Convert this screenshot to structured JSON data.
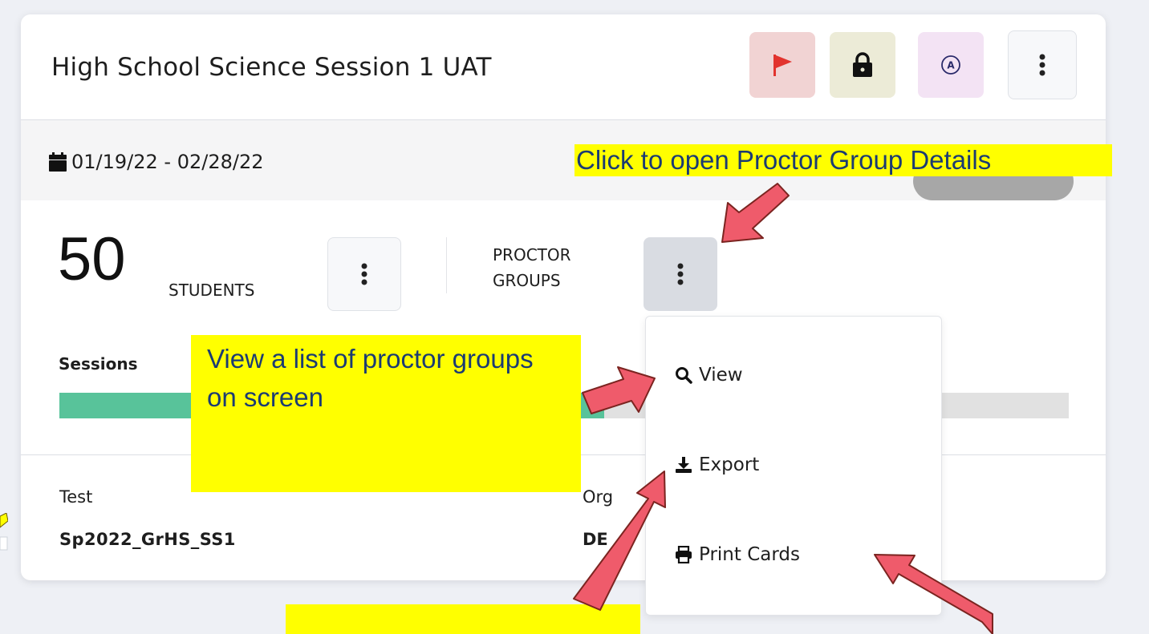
{
  "session": {
    "title": "High School Science Session 1 UAT",
    "date_range": "01/19/22 - 02/28/22",
    "student_count": "50",
    "students_label": "STUDENTS",
    "proctor_groups_label_line1": "PROCTOR",
    "proctor_groups_label_line2": "GROUPS",
    "sessions_label": "Sessions",
    "sessions_progress_fraction": 0.54,
    "test_label": "Test",
    "test_value": "Sp2022_GrHS_SS1",
    "org_label": "Org",
    "org_value": "DE"
  },
  "header_icons": [
    "flag-icon",
    "lock-icon",
    "accessibility-a-icon",
    "more-vertical-icon"
  ],
  "proctor_menu": {
    "items": [
      {
        "label": "View",
        "icon": "search-icon"
      },
      {
        "label": "Export",
        "icon": "download-icon"
      },
      {
        "label": "Print Cards",
        "icon": "print-icon"
      }
    ]
  },
  "callouts": {
    "top": "Click to open Proctor Group Details",
    "view": "View a list of proctor groups on screen",
    "bottom": ""
  },
  "colors": {
    "progress_fill": "#58c39a",
    "callout_bg": "#ffff00",
    "callout_text": "#1b3b73",
    "arrow": "#ef5b6b",
    "flag": "#e2332e"
  }
}
